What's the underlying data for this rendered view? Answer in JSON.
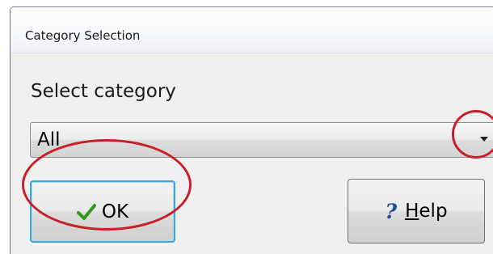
{
  "window": {
    "title": "Category Selection"
  },
  "form": {
    "label": "Select category",
    "combo": {
      "value": "All"
    }
  },
  "buttons": {
    "ok": {
      "label": "OK",
      "icon": "checkmark-icon",
      "icon_color": "#2f9a1a"
    },
    "help": {
      "label_mnemonic": "H",
      "label_rest": "elp",
      "icon": "question-mark-icon",
      "icon_color": "#1d4f9c"
    }
  },
  "annotations": {
    "color": "#c8202b",
    "highlighted": [
      "ok-button",
      "combo-dropdown-arrow"
    ]
  }
}
